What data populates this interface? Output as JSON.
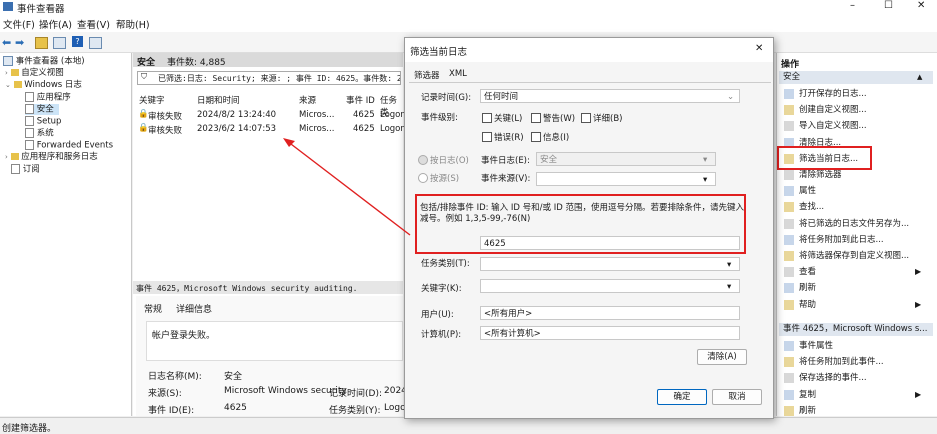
{
  "window": {
    "title": "事件查看器"
  },
  "menu": [
    "文件(F)",
    "操作(A)",
    "查看(V)",
    "帮助(H)"
  ],
  "tree": {
    "root": "事件查看器 (本地)",
    "custom_views": "自定义视图",
    "windows_logs": "Windows 日志",
    "application": "应用程序",
    "security": "安全",
    "setup": "Setup",
    "system": "系统",
    "forwarded": "Forwarded Events",
    "app_service": "应用程序和服务日志",
    "subscriptions": "订阅"
  },
  "center": {
    "header_name": "安全",
    "header_count": "事件数: 4,885",
    "filter_text": "已筛选:日志: Security; 来源: ; 事件 ID: 4625。事件数: 2",
    "columns": [
      "关键字",
      "日期和时间",
      "来源",
      "事件 ID",
      "任务类"
    ],
    "rows": [
      {
        "keyword": "审核失败",
        "datetime": "2024/8/2 13:24:40",
        "source": "Micros...",
        "id": "4625",
        "task": "Logon"
      },
      {
        "keyword": "审核失败",
        "datetime": "2023/6/2 14:07:53",
        "source": "Micros...",
        "id": "4625",
        "task": "Logon"
      }
    ],
    "detail_title": "事件 4625，Microsoft Windows security auditing.",
    "tabs": [
      "常规",
      "详细信息"
    ],
    "message": "帐户登录失败。",
    "log_name_label": "日志名称(M):",
    "log_name_value": "安全",
    "source_label": "来源(S):",
    "source_value": "Microsoft Windows security",
    "recorded_label": "记录时间(D):",
    "recorded_value": "2024/",
    "event_id_label": "事件 ID(E):",
    "event_id_value": "4625",
    "task_cat_label": "任务类别(Y):",
    "task_cat_value": "Logon"
  },
  "dialog": {
    "title": "筛选当前日志",
    "tabs": [
      "筛选器",
      "XML"
    ],
    "logged_label": "记录时间(G):",
    "logged_value": "任何时间",
    "level_label": "事件级别:",
    "levels": [
      "关键(L)",
      "警告(W)",
      "详细(B)",
      "错误(R)",
      "信息(I)"
    ],
    "by_log": "按日志(O)",
    "event_log_label": "事件日志(E):",
    "event_log_value": "安全",
    "by_source": "按源(S)",
    "event_source_label": "事件来源(V):",
    "include_label_1": "包括/排除事件 ID: 输入 ID 号和/或 ID 范围，使用逗号分隔。若要排除条件，请先键入",
    "include_label_2": "减号。例如 1,3,5-99,-76(N)",
    "event_id_input": "4625",
    "task_cat_label": "任务类别(T):",
    "keywords_label": "关键字(K):",
    "user_label": "用户(U):",
    "user_value": "<所有用户>",
    "computer_label": "计算机(P):",
    "computer_value": "<所有计算机>",
    "clear_button": "清除(A)",
    "ok_button": "确定",
    "cancel_button": "取消"
  },
  "actions": {
    "header": "操作",
    "section1": "安全",
    "items1": [
      "打开保存的日志...",
      "创建自定义视图...",
      "导入自定义视图...",
      "清除日志...",
      "筛选当前日志...",
      "清除筛选器",
      "属性",
      "查找...",
      "将已筛选的日志文件另存为...",
      "将任务附加到此日志...",
      "将筛选器保存到自定义视图...",
      "查看",
      "刷新",
      "帮助"
    ],
    "section2": "事件 4625，Microsoft Windows s...",
    "items2": [
      "事件属性",
      "将任务附加到此事件...",
      "保存选择的事件...",
      "复制",
      "刷新"
    ]
  },
  "status": {
    "text": "创建筛选器。"
  },
  "colors": {
    "highlight": "#e02020",
    "selection": "#cce4f7",
    "section": "#dfe6ef"
  }
}
